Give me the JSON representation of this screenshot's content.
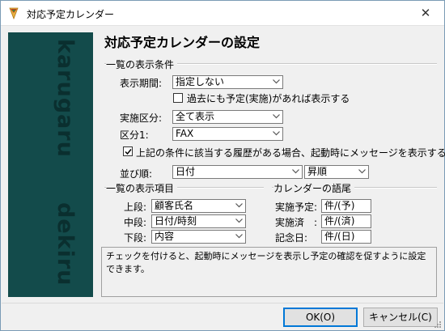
{
  "window": {
    "title": "対応予定カレンダー",
    "close_glyph": "✕"
  },
  "banner": {
    "words": [
      "karugaru",
      "dekiru"
    ],
    "background": "#134b4b"
  },
  "dialog": {
    "heading": "対応予定カレンダーの設定"
  },
  "list_conditions": {
    "title": "一覧の表示条件",
    "period_label": "表示期間:",
    "period_value": "指定しない",
    "past_checkbox_label": "過去にも予定(実施)があれば表示する",
    "past_checked": false,
    "category_label": "実施区分:",
    "category_value": "全て表示",
    "kubun_label": "区分1:",
    "kubun_value": "FAX",
    "startup_checkbox_label": "上記の条件に該当する履歴がある場合、起動時にメッセージを表示する",
    "startup_checked": true,
    "sort_label": "並び順:",
    "sort_value": "日付",
    "sort_order_value": "昇順"
  },
  "display_items": {
    "title": "一覧の表示項目",
    "upper_label": "上段:",
    "upper_value": "顧客氏名",
    "middle_label": "中段:",
    "middle_value": "日付/時刻",
    "lower_label": "下段:",
    "lower_value": "内容"
  },
  "calendar_terms": {
    "title": "カレンダーの語尾",
    "planned_label": "実施予定:",
    "planned_value": "件/(予)",
    "done_label": "実施済　:",
    "done_value": "件/(済)",
    "anniversary_label": "記念日:",
    "anniversary_value": "件/(日)"
  },
  "description": "チェックを付けると、起動時にメッセージを表示し予定の確認を促すように設定できます。",
  "buttons": {
    "ok": "OK(O)",
    "cancel": "キャンセル(C)"
  }
}
